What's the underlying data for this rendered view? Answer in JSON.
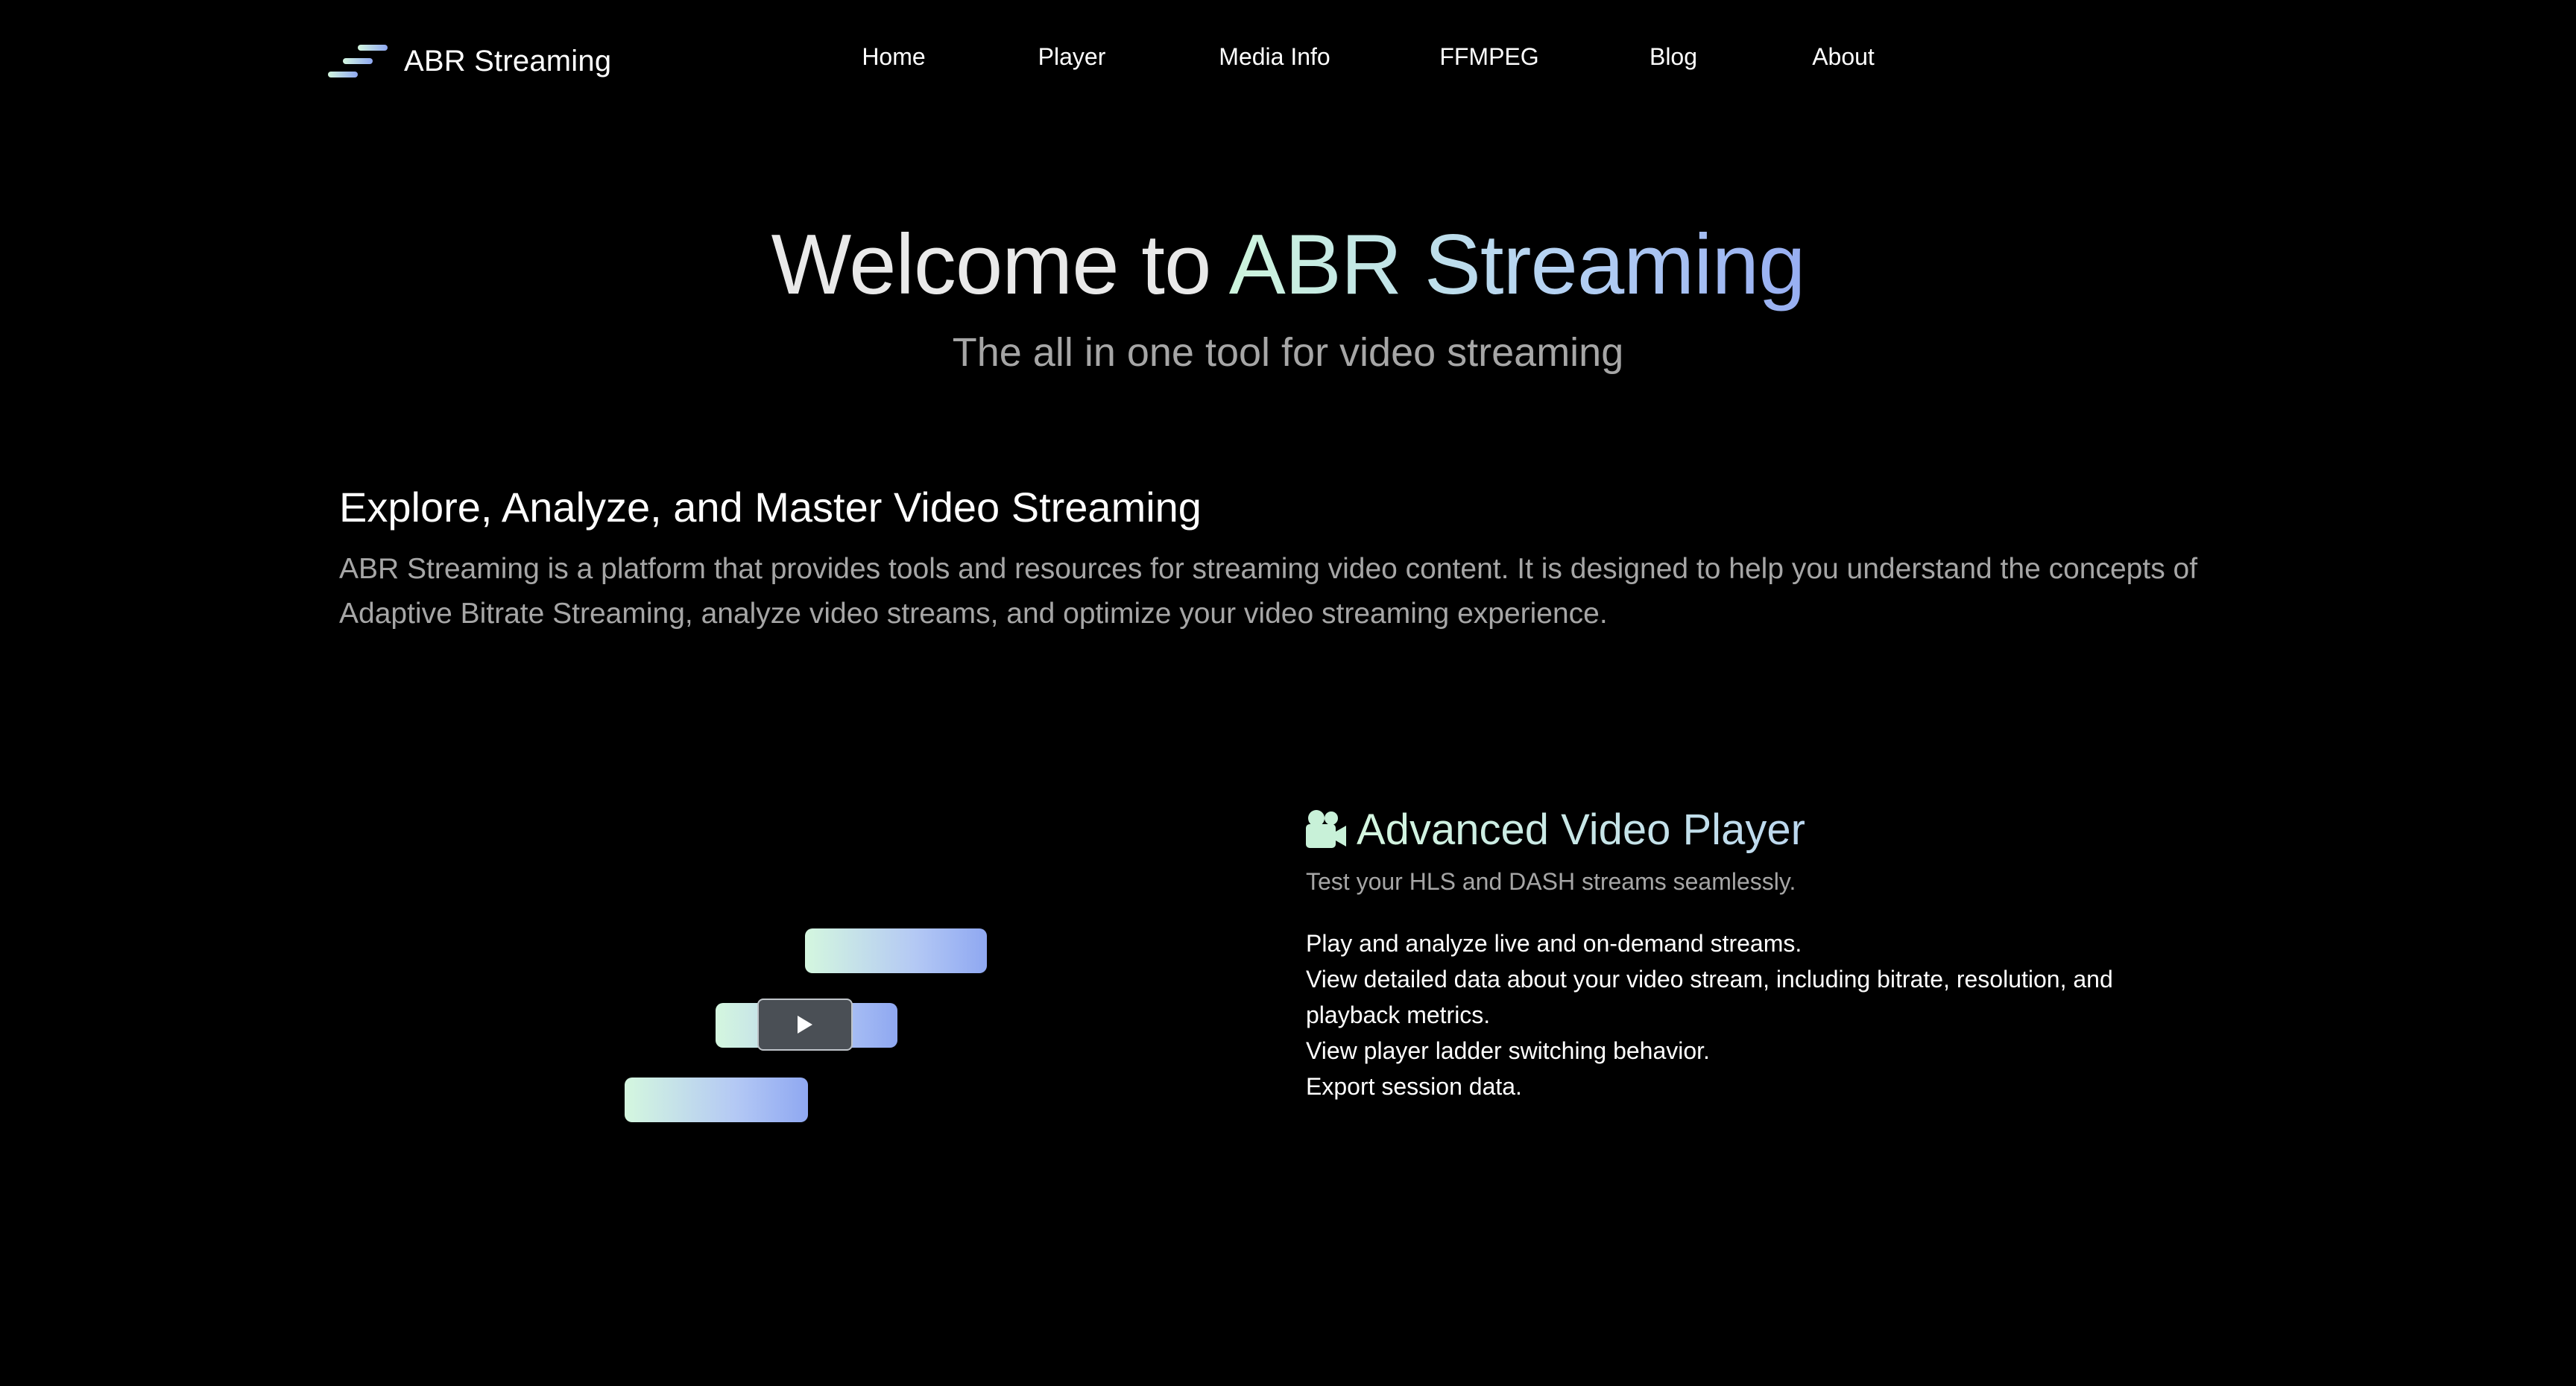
{
  "brand": {
    "name": "ABR Streaming",
    "logo_icon": "stacked-bars-logo-icon",
    "gradient_start": "#cdf5dc",
    "gradient_end": "#97aef2"
  },
  "nav": {
    "items": [
      {
        "label": "Home"
      },
      {
        "label": "Player"
      },
      {
        "label": "Media Info"
      },
      {
        "label": "FFMPEG"
      },
      {
        "label": "Blog"
      },
      {
        "label": "About"
      }
    ]
  },
  "hero": {
    "title_prefix": "Welcome to",
    "title_accent": "ABR Streaming",
    "subtitle": "The all in one tool for video streaming"
  },
  "intro": {
    "heading": "Explore, Analyze, and Master Video Streaming",
    "body": "ABR Streaming is a platform that provides tools and resources for streaming video content. It is designed to help you understand the concepts of Adaptive Bitrate Streaming, analyze video streams, and optimize your video streaming experience."
  },
  "illustration": {
    "play_icon": "play-icon"
  },
  "feature": {
    "icon": "movie-camera-icon",
    "title": "Advanced Video Player",
    "tagline": "Test your HLS and DASH streams seamlessly.",
    "points": [
      "Play and analyze live and on-demand streams.",
      "View detailed data about your video stream, including bitrate, resolution, and playback metrics.",
      "View player ladder switching behavior.",
      "Export session data."
    ]
  }
}
